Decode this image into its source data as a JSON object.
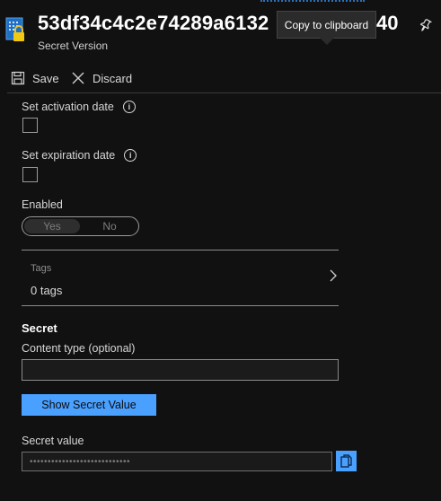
{
  "header": {
    "title": "53df34c4c2e74289a6132",
    "title_tail": "40",
    "subtitle": "Secret Version",
    "tooltip": "Copy to clipboard"
  },
  "toolbar": {
    "save_label": "Save",
    "discard_label": "Discard"
  },
  "form": {
    "activation_label": "Set activation date",
    "expiration_label": "Set expiration date",
    "enabled_label": "Enabled",
    "enabled_yes": "Yes",
    "enabled_no": "No",
    "tags_label": "Tags",
    "tags_value": "0 tags",
    "secret_section": "Secret",
    "content_type_label": "Content type (optional)",
    "content_type_value": "",
    "show_secret_label": "Show Secret Value",
    "secret_value_label": "Secret value",
    "secret_value_masked": "••••••••••••••••••••••••••••"
  },
  "icons": {
    "header_icon": "key-vault-secret-icon",
    "pin": "pin-icon",
    "save": "save-icon",
    "discard": "close-icon",
    "info": "info-icon",
    "chevron": "chevron-right-icon",
    "copy": "copy-icon"
  },
  "colors": {
    "accent": "#4aa0ff",
    "background": "#111111"
  }
}
